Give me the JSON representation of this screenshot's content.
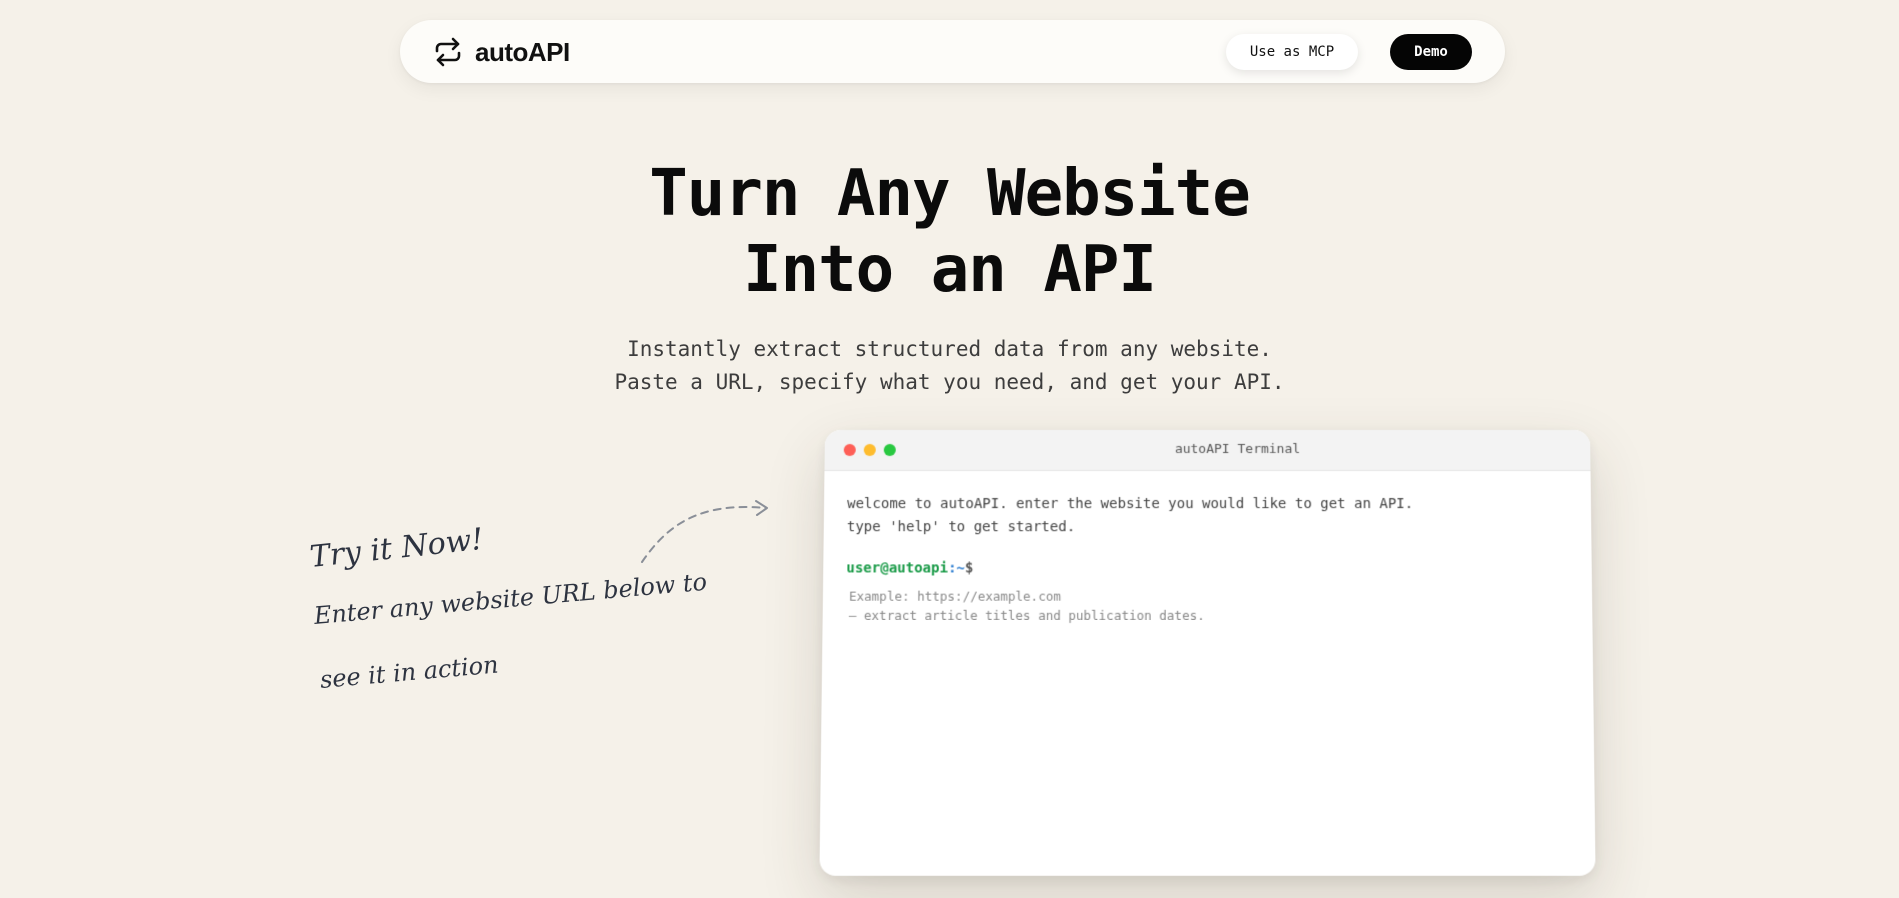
{
  "nav": {
    "brand": "autoAPI",
    "brand_icon": "repeat-arrows-icon",
    "mcp_button": "Use as MCP",
    "demo_button": "Demo"
  },
  "hero": {
    "title_line1": "Turn Any Website",
    "title_line2": "Into an API",
    "subtitle_line1": "Instantly extract structured data from any website.",
    "subtitle_line2": "Paste a URL, specify what you need, and get your API."
  },
  "note": {
    "title": "Try it Now!",
    "line1": "Enter any website URL below to",
    "line2": "see it in action"
  },
  "terminal": {
    "title": "autoAPI Terminal",
    "welcome_line1": "welcome to autoAPI. enter the website you would like to get an API.",
    "welcome_line2": "type 'help' to get started.",
    "prompt_user": "user@autoapi",
    "prompt_path": ":~",
    "prompt_symbol": "$",
    "input_value": "",
    "input_placeholder": "Example: https://example.com\n— extract article titles and publication dates."
  },
  "colors": {
    "background": "#f5f1e9",
    "demo_button": "#050505",
    "prompt_user": "#1a9b48",
    "prompt_path": "#2f7fd1",
    "dot_red": "#fe5f57",
    "dot_yellow": "#febc2e",
    "dot_green": "#28c840"
  }
}
